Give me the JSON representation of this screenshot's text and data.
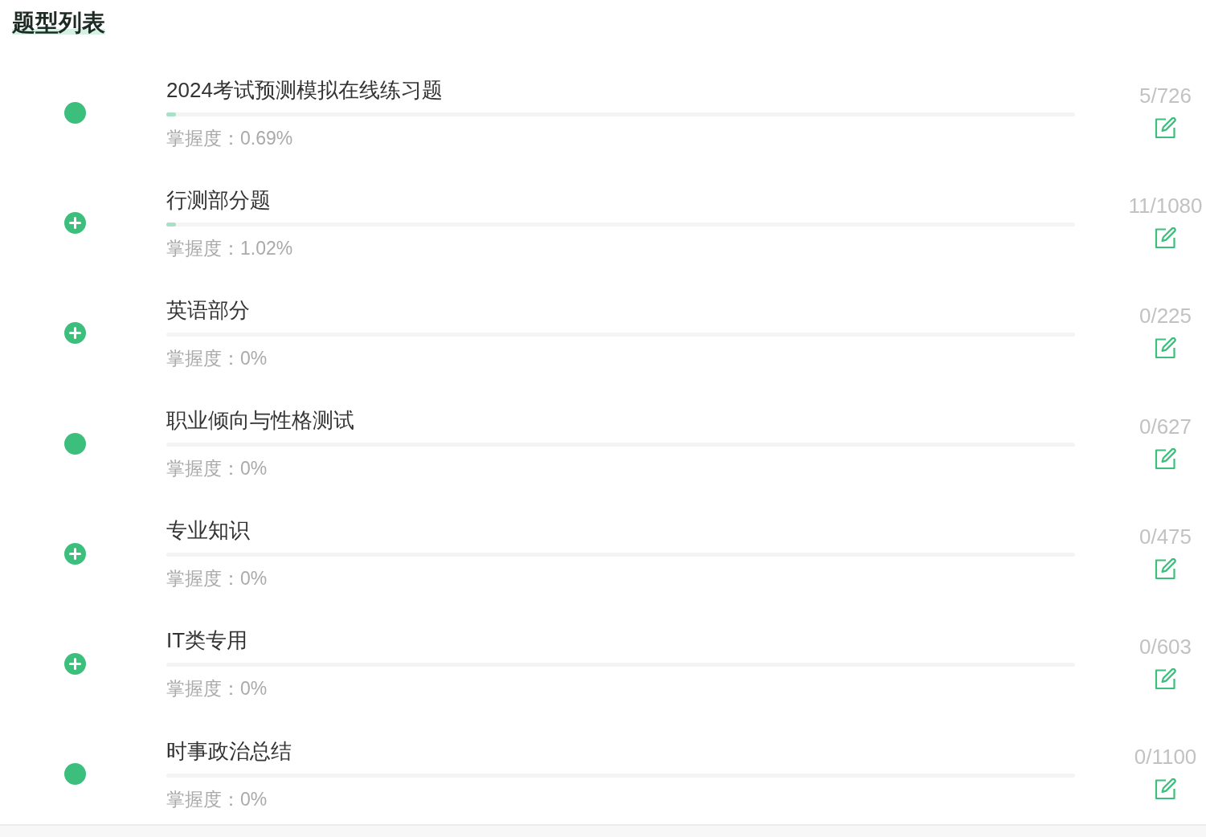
{
  "header": {
    "title": "题型列表"
  },
  "rows": [
    {
      "kind": "dot",
      "name": "2024考试预测模拟在线练习题",
      "level": 0.0069,
      "mastery": "掌握度：0.69%",
      "count": "5/726"
    },
    {
      "kind": "plus",
      "name": "行测部分题",
      "level": 0.0102,
      "mastery": "掌握度：1.02%",
      "count": "11/1080"
    },
    {
      "kind": "plus",
      "name": "英语部分",
      "mastery": "掌握度：0%",
      "count": "0/225"
    },
    {
      "kind": "dot",
      "name": "职业倾向与性格测试",
      "mastery": "掌握度：0%",
      "count": "0/627"
    },
    {
      "kind": "plus",
      "name": "专业知识",
      "mastery": "掌握度：0%",
      "count": "0/475"
    },
    {
      "kind": "plus",
      "name": "IT类专用",
      "mastery": "掌握度：0%",
      "count": "0/603"
    },
    {
      "kind": "dot",
      "name": "时事政治总结",
      "mastery": "掌握度：0%",
      "count": "0/1100"
    }
  ]
}
